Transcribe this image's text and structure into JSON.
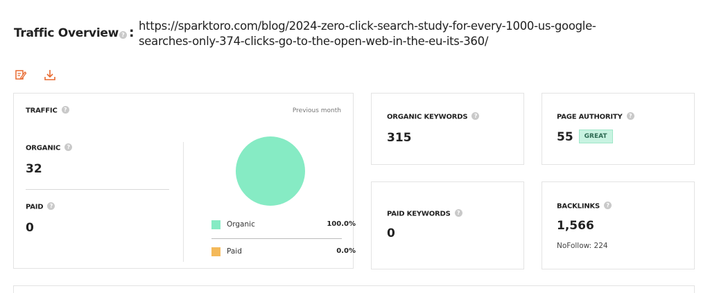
{
  "header": {
    "title": "Traffic Overview",
    "colon": ":",
    "url_line1": "https://sparktoro.com/blog/2024-zero-click-search-study-for-every-1000-us-google-",
    "url_line2": "searches-only-374-clicks-go-to-the-open-web-in-the-eu-its-360/"
  },
  "toolbar": {
    "edit_icon": "edit-note-icon",
    "download_icon": "download-icon"
  },
  "help_glyph": "?",
  "traffic": {
    "label": "TRAFFIC",
    "period": "Previous month",
    "organic_label": "ORGANIC",
    "organic_value": "32",
    "paid_label": "PAID",
    "paid_value": "0",
    "legend": [
      {
        "name": "Organic",
        "pct": "100.0%",
        "color": "#86ebc4"
      },
      {
        "name": "Paid",
        "pct": "0.0%",
        "color": "#f4b95a"
      }
    ]
  },
  "chart_data": {
    "type": "pie",
    "title": "",
    "categories": [
      "Organic",
      "Paid"
    ],
    "values": [
      100.0,
      0.0
    ],
    "colors": [
      "#86ebc4",
      "#f4b95a"
    ]
  },
  "organic_keywords": {
    "label": "ORGANIC KEYWORDS",
    "value": "315"
  },
  "paid_keywords": {
    "label": "PAID KEYWORDS",
    "value": "0"
  },
  "page_authority": {
    "label": "PAGE AUTHORITY",
    "value": "55",
    "badge": "GREAT"
  },
  "backlinks": {
    "label": "BACKLINKS",
    "value": "1,566",
    "nofollow": "NoFollow: 224"
  },
  "colors": {
    "accent": "#e8692f",
    "border": "#e3e3e3",
    "help": "#c9c9c9"
  }
}
